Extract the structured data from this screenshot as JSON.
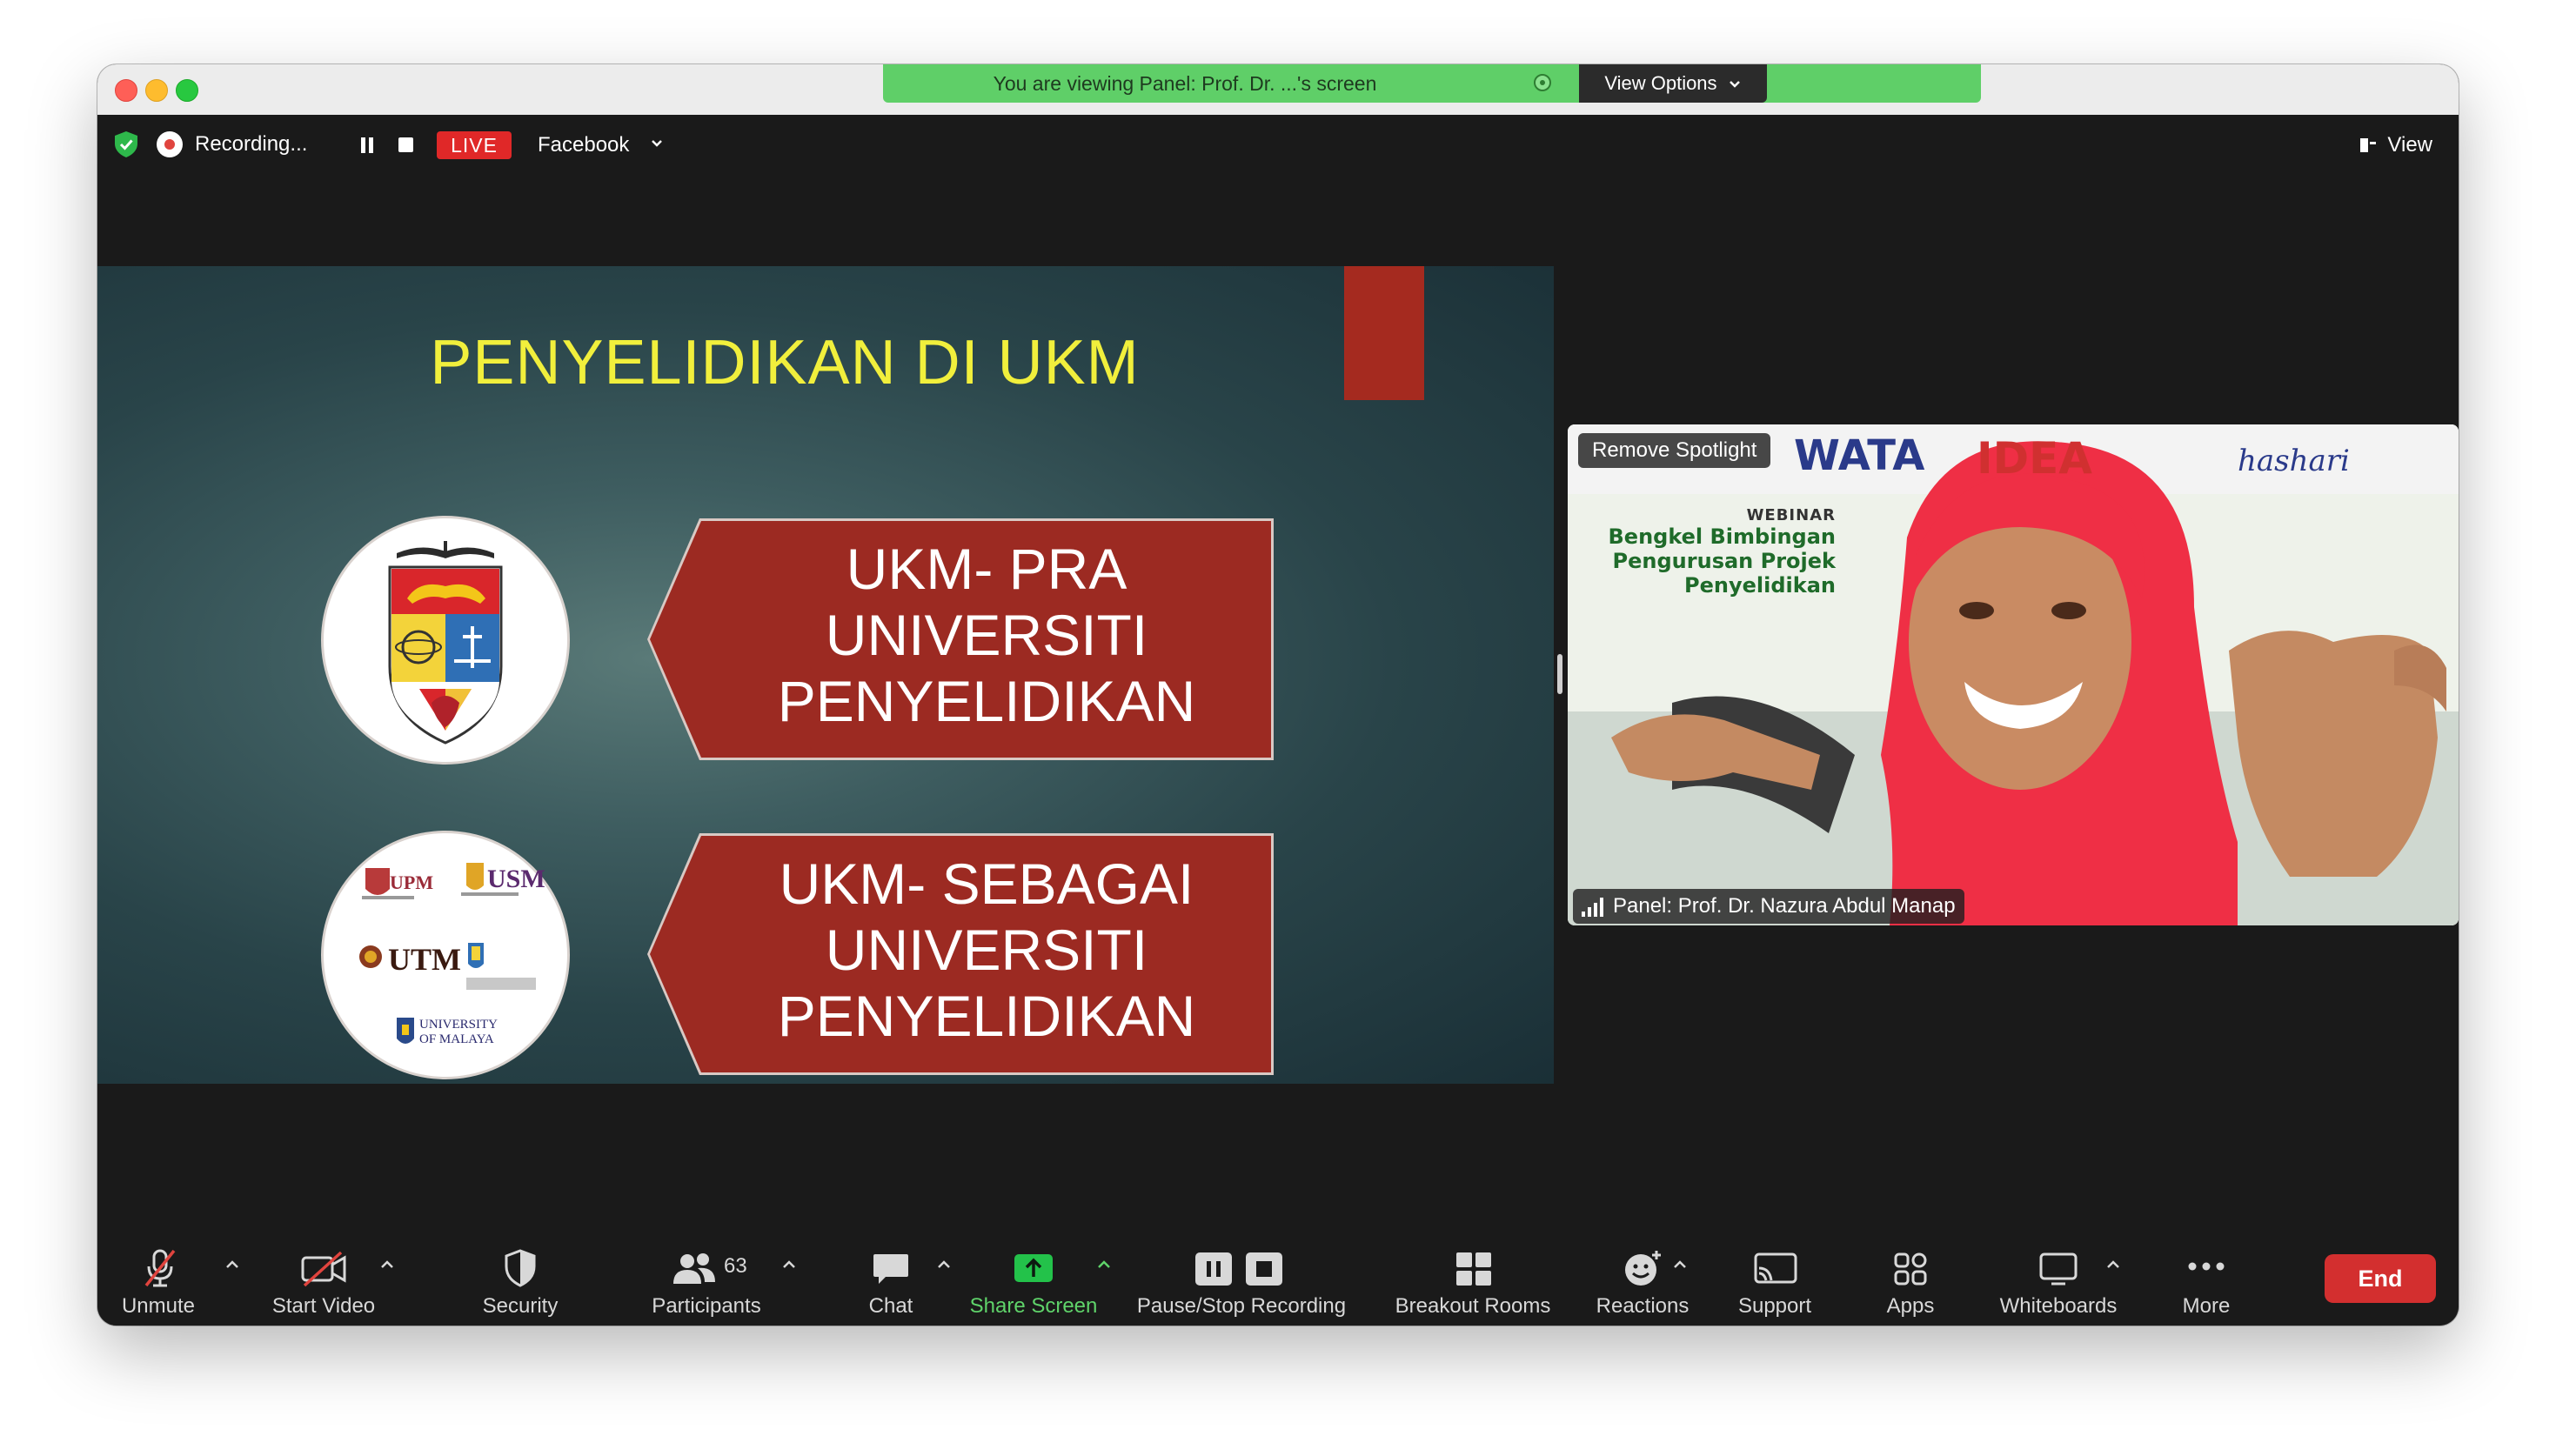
{
  "window": {
    "viewing_banner": "You are viewing Panel: Prof. Dr. ...'s screen",
    "view_options": "View Options"
  },
  "topbar": {
    "recording": "Recording...",
    "live": "LIVE",
    "platform": "Facebook",
    "view": "View"
  },
  "slide": {
    "title": "PENYELIDIKAN DI UKM",
    "banner1": [
      "UKM- PRA",
      "UNIVERSITI",
      "PENYELIDIKAN"
    ],
    "banner2": [
      "UKM- SEBAGAI",
      "UNIVERSITI",
      "PENYELIDIKAN"
    ],
    "logos": {
      "upm": "UPM",
      "usm": "USM",
      "utm": "UTM",
      "um": [
        "UNIVERSITY",
        "OF MALAYA"
      ]
    }
  },
  "video": {
    "remove_spotlight": "Remove Spotlight",
    "participant_name": "Panel: Prof. Dr. Nazura Abdul Manap",
    "backdrop": {
      "brand1": "WATA",
      "brand2": "IDEA",
      "brand3": "hashari",
      "webinar": "WEBINAR",
      "lines": [
        "Bengkel Bimbingan",
        "Pengurusan Projek",
        "Penyelidikan"
      ]
    }
  },
  "toolbar": {
    "unmute": "Unmute",
    "start_video": "Start Video",
    "security": "Security",
    "participants": "Participants",
    "participants_count": "63",
    "chat": "Chat",
    "share_screen": "Share Screen",
    "pause_stop": "Pause/Stop Recording",
    "breakout": "Breakout Rooms",
    "reactions": "Reactions",
    "support": "Support",
    "apps": "Apps",
    "whiteboards": "Whiteboards",
    "more": "More",
    "end": "End"
  },
  "colors": {
    "share_green": "#5fcf68",
    "live_red": "#e02828",
    "end_red": "#d32f2f",
    "slide_title_yellow": "#f1ef3c",
    "banner_red": "#9c2a22"
  }
}
